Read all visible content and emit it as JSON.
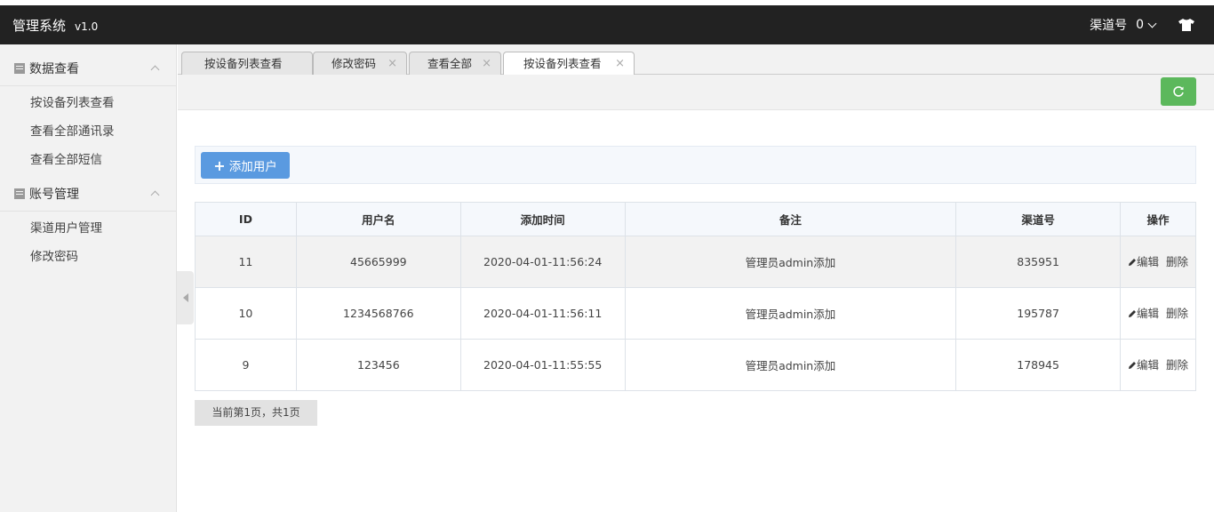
{
  "app": {
    "title": "管理系统",
    "version": "v1.0"
  },
  "header": {
    "channel_label": "渠道号",
    "channel_value": "0",
    "theme_icon": "tshirt-icon"
  },
  "sidebar": {
    "groups": [
      {
        "label": "数据查看",
        "items": [
          "按设备列表查看",
          "查看全部通讯录",
          "查看全部短信"
        ]
      },
      {
        "label": "账号管理",
        "items": [
          "渠道用户管理",
          "修改密码"
        ]
      }
    ]
  },
  "tabs": [
    {
      "label": "按设备列表查看",
      "closable": false,
      "active": false
    },
    {
      "label": "修改密码",
      "closable": true,
      "active": false
    },
    {
      "label": "查看全部",
      "closable": true,
      "active": false
    },
    {
      "label": "按设备列表查看",
      "closable": true,
      "active": true
    }
  ],
  "close_glyph": "×",
  "toolbar": {
    "refresh_icon": "refresh-icon",
    "refresh_color": "#5cb85c"
  },
  "actions": {
    "add_user": "添加用户",
    "add_icon": "+"
  },
  "table": {
    "columns": [
      "ID",
      "用户名",
      "添加时间",
      "备注",
      "渠道号",
      "操作"
    ],
    "rows": [
      {
        "id": "11",
        "username": "45665999",
        "time": "2020-04-01-11:56:24",
        "remark": "管理员admin添加",
        "channel": "835951"
      },
      {
        "id": "10",
        "username": "1234568766",
        "time": "2020-04-01-11:56:11",
        "remark": "管理员admin添加",
        "channel": "195787"
      },
      {
        "id": "9",
        "username": "123456",
        "time": "2020-04-01-11:55:55",
        "remark": "管理员admin添加",
        "channel": "178945"
      }
    ],
    "edit_label": "编辑",
    "delete_label": "删除"
  },
  "pager": {
    "text": "当前第1页，共1页"
  },
  "colors": {
    "header_bg": "#222222",
    "add_button": "#5a9ae0",
    "refresh_button": "#5cb85c"
  }
}
